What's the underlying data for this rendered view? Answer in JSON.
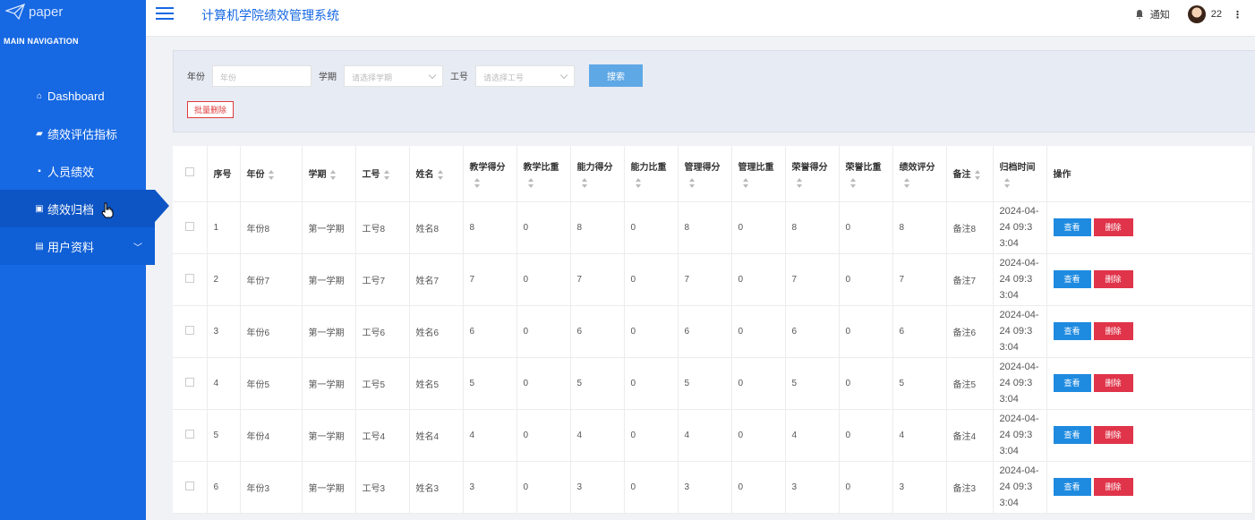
{
  "sidebar": {
    "logo_text": "paper",
    "nav_header": "MAIN NAVIGATION",
    "items": [
      {
        "label": "Dashboard",
        "icon": "home-icon"
      },
      {
        "label": "绩效评估指标",
        "icon": "folder-icon"
      },
      {
        "label": "人员绩效",
        "icon": "book-icon"
      },
      {
        "label": "绩效归档",
        "icon": "chart-icon"
      },
      {
        "label": "用户资料",
        "icon": "id-card-icon"
      }
    ]
  },
  "header": {
    "title": "计算机学院绩效管理系统",
    "notification_label": "通知",
    "user_label": "22"
  },
  "search": {
    "year_label": "年份",
    "year_placeholder": "年份",
    "term_label": "学期",
    "term_placeholder": "请选择学期",
    "job_label": "工号",
    "job_placeholder": "请选择工号",
    "search_button": "搜索",
    "batch_delete_button": "批量删除"
  },
  "table": {
    "columns": [
      "序号",
      "年份",
      "学期",
      "工号",
      "姓名",
      "教学得分",
      "教学比重",
      "能力得分",
      "能力比重",
      "管理得分",
      "管理比重",
      "荣誉得分",
      "荣誉比重",
      "绩效评分",
      "备注",
      "归档时间",
      "操作"
    ],
    "view_label": "查看",
    "delete_label": "删除",
    "rows": [
      {
        "no": "1",
        "year": "年份8",
        "term": "第一学期",
        "job": "工号8",
        "name": "姓名8",
        "teach": "8",
        "teach_w": "0",
        "ability": "8",
        "ability_w": "0",
        "manage": "8",
        "manage_w": "0",
        "honor": "8",
        "honor_w": "0",
        "perf": "8",
        "note": "备注8",
        "time": "2024-04-24 09:33:04"
      },
      {
        "no": "2",
        "year": "年份7",
        "term": "第一学期",
        "job": "工号7",
        "name": "姓名7",
        "teach": "7",
        "teach_w": "0",
        "ability": "7",
        "ability_w": "0",
        "manage": "7",
        "manage_w": "0",
        "honor": "7",
        "honor_w": "0",
        "perf": "7",
        "note": "备注7",
        "time": "2024-04-24 09:33:04"
      },
      {
        "no": "3",
        "year": "年份6",
        "term": "第一学期",
        "job": "工号6",
        "name": "姓名6",
        "teach": "6",
        "teach_w": "0",
        "ability": "6",
        "ability_w": "0",
        "manage": "6",
        "manage_w": "0",
        "honor": "6",
        "honor_w": "0",
        "perf": "6",
        "note": "备注6",
        "time": "2024-04-24 09:33:04"
      },
      {
        "no": "4",
        "year": "年份5",
        "term": "第一学期",
        "job": "工号5",
        "name": "姓名5",
        "teach": "5",
        "teach_w": "0",
        "ability": "5",
        "ability_w": "0",
        "manage": "5",
        "manage_w": "0",
        "honor": "5",
        "honor_w": "0",
        "perf": "5",
        "note": "备注5",
        "time": "2024-04-24 09:33:04"
      },
      {
        "no": "5",
        "year": "年份4",
        "term": "第一学期",
        "job": "工号4",
        "name": "姓名4",
        "teach": "4",
        "teach_w": "0",
        "ability": "4",
        "ability_w": "0",
        "manage": "4",
        "manage_w": "0",
        "honor": "4",
        "honor_w": "0",
        "perf": "4",
        "note": "备注4",
        "time": "2024-04-24 09:33:04"
      },
      {
        "no": "6",
        "year": "年份3",
        "term": "第一学期",
        "job": "工号3",
        "name": "姓名3",
        "teach": "3",
        "teach_w": "0",
        "ability": "3",
        "ability_w": "0",
        "manage": "3",
        "manage_w": "0",
        "honor": "3",
        "honor_w": "0",
        "perf": "3",
        "note": "备注3",
        "time": "2024-04-24 09:33:04"
      }
    ]
  }
}
